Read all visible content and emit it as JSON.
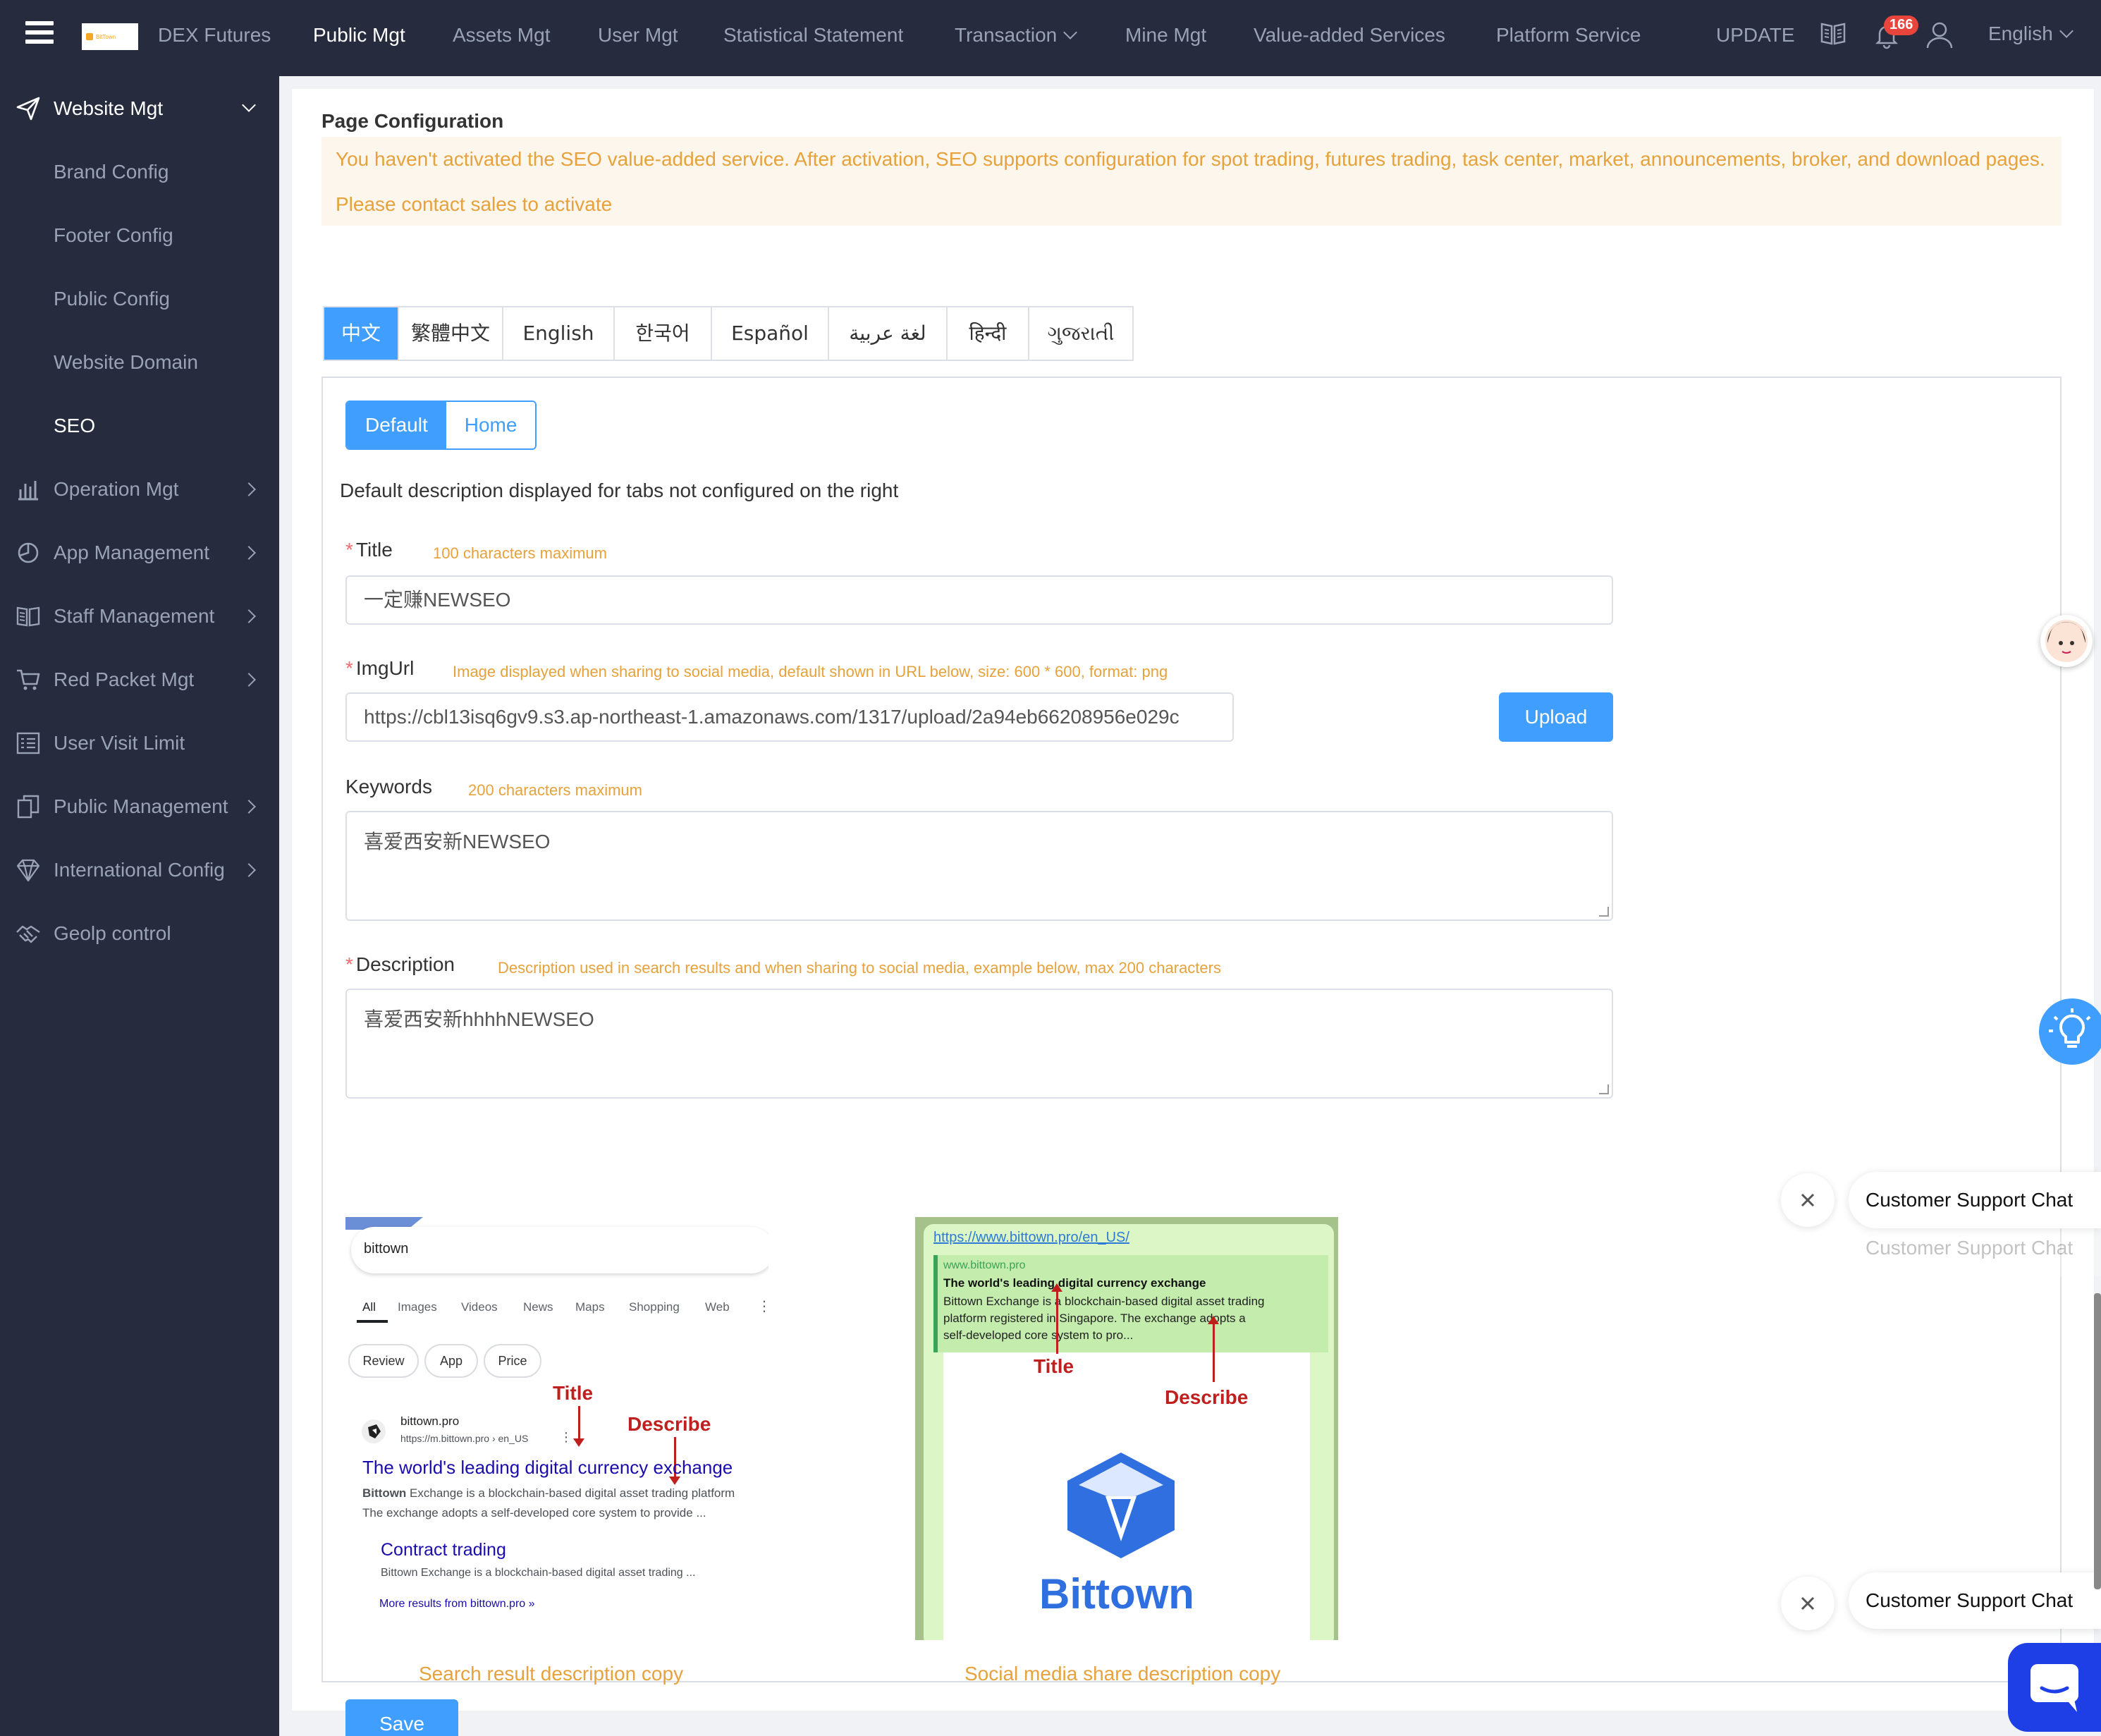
{
  "topnav": {
    "logo_text": "BitTown",
    "items": [
      "DEX Futures",
      "Public Mgt",
      "Assets Mgt",
      "User Mgt",
      "Statistical Statement",
      "Transaction",
      "Mine Mgt",
      "Value-added Services",
      "Platform Service"
    ],
    "active": "Public Mgt",
    "update_label": "UPDATE",
    "notification_count": "166",
    "language": "English"
  },
  "sidebar": {
    "group_open": "Website Mgt",
    "sub_items": [
      "Brand Config",
      "Footer Config",
      "Public Config",
      "Website Domain",
      "SEO"
    ],
    "active_sub": "SEO",
    "items": [
      "Operation Mgt",
      "App Management",
      "Staff Management",
      "Red Packet Mgt",
      "User Visit Limit",
      "Public Management",
      "International Config",
      "Geolp control"
    ]
  },
  "page": {
    "title": "Page Configuration",
    "notice": "You haven't activated the SEO value-added service. After activation, SEO supports configuration for spot trading, futures trading, task center, market, announcements, broker, and download pages. Please contact sales to activate",
    "languages": [
      "中文",
      "繁體中文",
      "English",
      "한국어",
      "Español",
      "لغة عربية",
      "हिन्दी",
      "ગુજરાતી"
    ],
    "active_language": "中文",
    "page_tabs": [
      "Default",
      "Home"
    ],
    "active_page_tab": "Default",
    "default_hint": "Default description displayed for tabs not configured on the right"
  },
  "form": {
    "title_label": "Title",
    "title_hint": "100 characters maximum",
    "title_value": "一定赚NEWSEO",
    "imgurl_label": "ImgUrl",
    "imgurl_hint": "Image displayed when sharing to social media, default shown in URL below, size: 600 * 600, format: png",
    "imgurl_value": "https://cbl13isq6gv9.s3.ap-northeast-1.amazonaws.com/1317/upload/2a94eb66208956e029c",
    "upload_label": "Upload",
    "keywords_label": "Keywords",
    "keywords_hint": "200 characters maximum",
    "keywords_value": "喜爱西安新NEWSEO",
    "description_label": "Description",
    "description_hint": "Description used in search results and when sharing to social media, example below, max 200 characters",
    "description_value": "喜爱西安新hhhhNEWSEO",
    "save_label": "Save"
  },
  "example_search": {
    "query": "bittown",
    "tabs": [
      "All",
      "Images",
      "Videos",
      "News",
      "Maps",
      "Shopping",
      "Web"
    ],
    "pills": [
      "Review",
      "App",
      "Price"
    ],
    "title_marker": "Title",
    "describe_marker": "Describe",
    "site_name": "bittown.pro",
    "site_url": "https://m.bittown.pro › en_US",
    "result_title": "The world's leading digital currency exchange",
    "result_desc_1_bold": "Bittown",
    "result_desc_1": " Exchange is a blockchain-based digital asset trading platform",
    "result_desc_2": "The exchange adopts a self-developed core system to provide ...",
    "sub_title": "Contract trading",
    "sub_desc": "Bittown Exchange is a blockchain-based digital asset trading ...",
    "more": "More results from bittown.pro »",
    "caption": "Search result description copy"
  },
  "example_social": {
    "link": "https://www.bittown.pro/en_US/",
    "domain": "www.bittown.pro",
    "headline": "The world's leading digital currency exchange",
    "desc_1": "Bittown Exchange is a blockchain-based digital asset trading",
    "desc_2": "platform registered in Singapore. The exchange adopts a",
    "desc_3": "self-developed core system to pro...",
    "title_marker": "Title",
    "describe_marker": "Describe",
    "brand": "Bittown",
    "caption": "Social media share description copy"
  },
  "chat": {
    "label_1": "Customer Support Chat",
    "label_2": "Customer Support Chat",
    "label_3": "Customer Support Chat"
  },
  "colors": {
    "nav_bg": "#262b3d",
    "primary": "#409eff",
    "warning": "#e6a23c",
    "danger": "#f56c6c",
    "chat": "#1e3ee6"
  }
}
